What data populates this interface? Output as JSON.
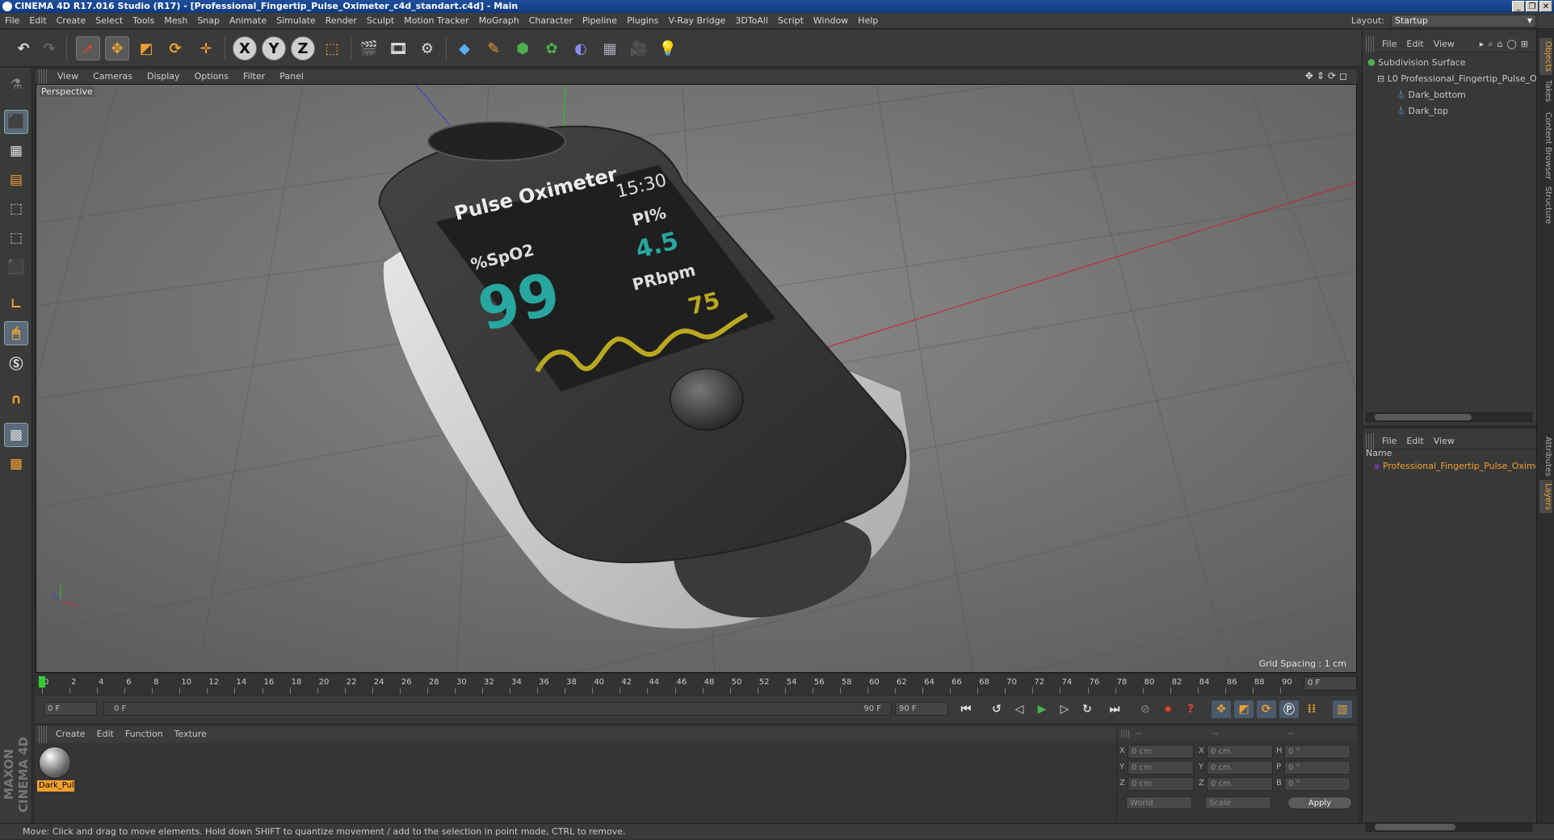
{
  "window": {
    "title": "CINEMA 4D R17.016 Studio (R17) - [Professional_Fingertip_Pulse_Oximeter_c4d_standart.c4d] - Main",
    "controls": [
      "_",
      "❐",
      "✕"
    ]
  },
  "menubar": {
    "items": [
      "File",
      "Edit",
      "Create",
      "Select",
      "Tools",
      "Mesh",
      "Snap",
      "Animate",
      "Simulate",
      "Render",
      "Sculpt",
      "Motion Tracker",
      "MoGraph",
      "Character",
      "Pipeline",
      "Plugins",
      "V-Ray Bridge",
      "3DToAll",
      "Script",
      "Window",
      "Help"
    ],
    "layout_label": "Layout:",
    "layout_value": "Startup"
  },
  "toolbar": {
    "icons": [
      "undo-icon",
      "redo-icon",
      "live-selection-icon",
      "move-icon",
      "scale-icon",
      "rotate-icon",
      "recent-tool-icon",
      "x-axis-icon",
      "y-axis-icon",
      "z-axis-icon",
      "coordinate-system-icon",
      "render-view-icon",
      "render-picture-viewer-icon",
      "edit-render-settings-icon",
      "cube-icon",
      "pen-icon",
      "subdivision-icon",
      "array-icon",
      "deformer-icon",
      "floor-icon",
      "camera-icon",
      "light-icon"
    ],
    "axis_labels": [
      "X",
      "Y",
      "Z"
    ]
  },
  "viewport": {
    "menu": [
      "View",
      "Cameras",
      "Display",
      "Options",
      "Filter",
      "Panel"
    ],
    "camera_label": "Perspective",
    "grid_spacing": "Grid Spacing : 1 cm",
    "device": {
      "brand": "Pulse Oximeter",
      "time": "15:30",
      "pi_label": "PI%",
      "pi_value": "4.5",
      "spo2_label": "%SpO2",
      "spo2_value": "99",
      "pr_label": "PRbpm",
      "pr_value": "75"
    }
  },
  "timeline": {
    "ticks": [
      "0",
      "2",
      "4",
      "6",
      "8",
      "10",
      "12",
      "14",
      "16",
      "18",
      "20",
      "22",
      "24",
      "26",
      "28",
      "30",
      "32",
      "34",
      "36",
      "38",
      "40",
      "42",
      "44",
      "46",
      "48",
      "50",
      "52",
      "54",
      "56",
      "58",
      "60",
      "62",
      "64",
      "66",
      "68",
      "70",
      "72",
      "74",
      "76",
      "78",
      "80",
      "82",
      "84",
      "86",
      "88",
      "90"
    ],
    "current_frame": "0 F"
  },
  "transport": {
    "start_field": "0 F",
    "range_start": "0 F",
    "range_end": "90 F",
    "end_field": "90 F"
  },
  "material_manager": {
    "menu": [
      "Create",
      "Edit",
      "Function",
      "Texture"
    ],
    "material_name": "Dark_Pul"
  },
  "coordinates": {
    "header": [
      "--",
      "--",
      "--"
    ],
    "rows": [
      {
        "a": "X",
        "av": "0 cm",
        "b": "X",
        "bv": "0 cm",
        "c": "H",
        "cv": "0 °"
      },
      {
        "a": "Y",
        "av": "0 cm",
        "b": "Y",
        "bv": "0 cm",
        "c": "P",
        "cv": "0 °"
      },
      {
        "a": "Z",
        "av": "0 cm",
        "b": "Z",
        "bv": "0 cm",
        "c": "B",
        "cv": "0 °"
      }
    ],
    "mode": "World",
    "scale": "Scale",
    "apply": "Apply"
  },
  "object_manager": {
    "menu": [
      "File",
      "Edit",
      "View"
    ],
    "objects": [
      {
        "name": "Subdivision Surface"
      },
      {
        "name": "Professional_Fingertip_Pulse_Oxim"
      },
      {
        "name": "Dark_bottom"
      },
      {
        "name": "Dark_top"
      }
    ]
  },
  "layer_manager": {
    "menu": [
      "File",
      "Edit",
      "View"
    ],
    "column": "Name",
    "item": "Professional_Fingertip_Pulse_Oxime"
  },
  "side_tabs": {
    "top": [
      "Objects",
      "Takes",
      "Content Browser",
      "Structure"
    ],
    "bottom": [
      "Attributes",
      "Layers"
    ]
  },
  "maxon_logo": "MAXON CINEMA 4D",
  "statusbar": "Move: Click and drag to move elements. Hold down SHIFT to quantize movement / add to the selection in point mode, CTRL to remove.",
  "colors": {
    "accent": "#f0a030",
    "selection": "#2a7fd4",
    "titlebar": "#0e3a80"
  }
}
